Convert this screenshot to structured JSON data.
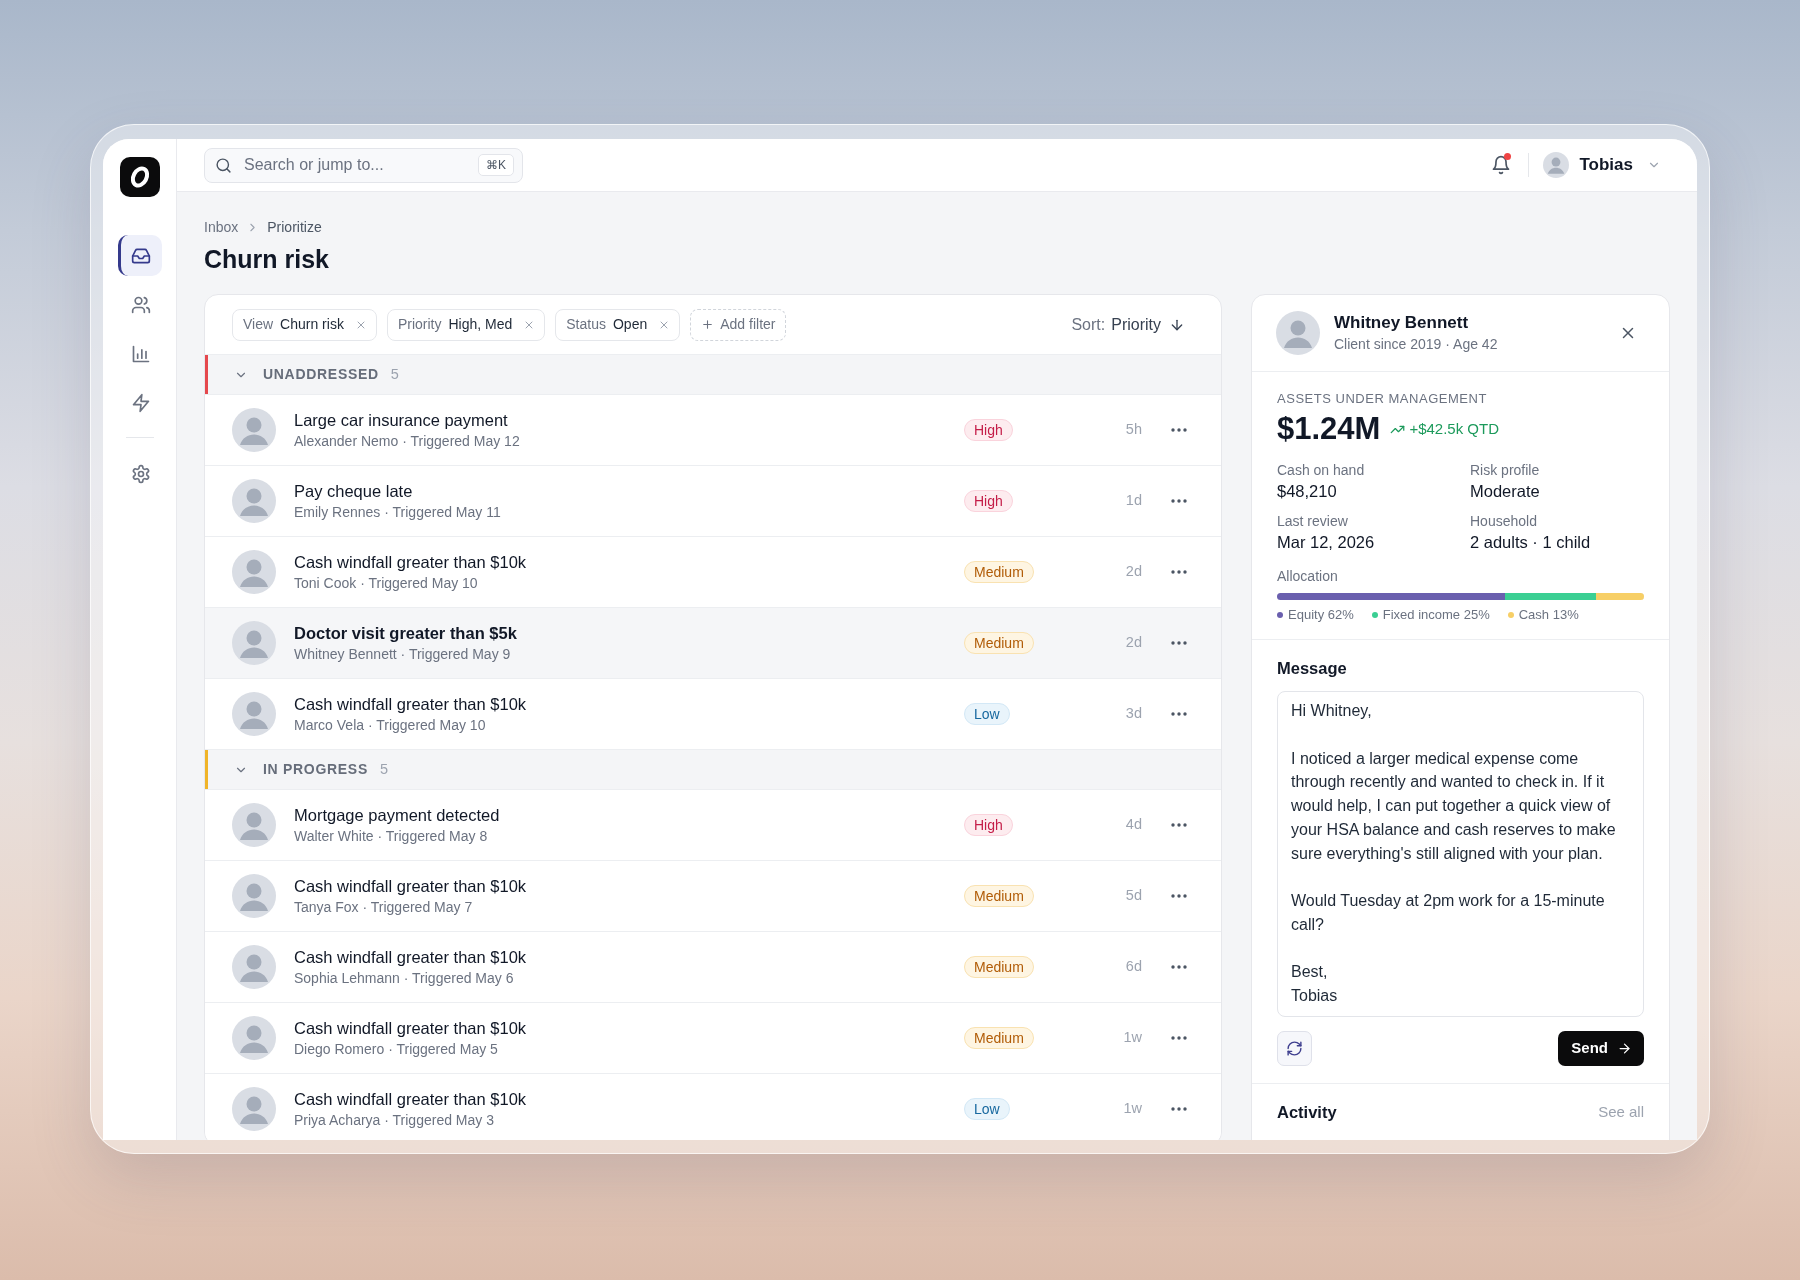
{
  "sidebar": {
    "items": [
      {
        "selected": true
      },
      {
        "selected": false
      },
      {
        "selected": false
      },
      {
        "selected": false
      }
    ],
    "footer_items": [
      {
        "selected": false
      }
    ]
  },
  "search": {
    "placeholder": "Search or jump to...",
    "shortcut": "⌘K"
  },
  "notifications": {
    "unread": true
  },
  "user": {
    "name": "Tobias"
  },
  "breadcrumb": [
    "Inbox",
    "Prioritize"
  ],
  "title": "Churn risk",
  "filters": [
    {
      "label": "View",
      "value": "Churn risk"
    },
    {
      "label": "Priority",
      "value": "High, Med"
    },
    {
      "label": "Status",
      "value": "Open"
    }
  ],
  "add_filter": "Add filter",
  "sort": {
    "label": "Sort:",
    "value": "Priority"
  },
  "groups": [
    {
      "title": "UNADDRESSED",
      "count": "5",
      "color": "#e5484d",
      "expanded": true,
      "rows": [
        {
          "title": "Large car insurance payment",
          "subtitle": "Alexander Nemo · Triggered May 12",
          "priority": {
            "label": "High",
            "kind": "high"
          },
          "age": "5h",
          "selected": false
        },
        {
          "title": "Pay cheque late",
          "subtitle": "Emily Rennes · Triggered May 11",
          "priority": {
            "label": "High",
            "kind": "high"
          },
          "age": "1d",
          "selected": false
        },
        {
          "title": "Cash windfall greater than $10k",
          "subtitle": "Toni Cook · Triggered May 10",
          "priority": {
            "label": "Medium",
            "kind": "medium"
          },
          "age": "2d",
          "selected": false
        },
        {
          "title": "Doctor visit greater than $5k",
          "subtitle": "Whitney Bennett · Triggered May 9",
          "priority": {
            "label": "Medium",
            "kind": "medium"
          },
          "age": "2d",
          "selected": true
        },
        {
          "title": "Cash windfall greater than $10k",
          "subtitle": "Marco Vela · Triggered May 10",
          "priority": {
            "label": "Low",
            "kind": "low"
          },
          "age": "3d",
          "selected": false
        }
      ]
    },
    {
      "title": "IN PROGRESS",
      "count": "5",
      "color": "#f0b429",
      "expanded": true,
      "rows": [
        {
          "title": "Mortgage payment detected",
          "subtitle": "Walter White · Triggered May 8",
          "priority": {
            "label": "High",
            "kind": "high"
          },
          "age": "4d",
          "selected": false
        },
        {
          "title": "Cash windfall greater than $10k",
          "subtitle": "Tanya Fox · Triggered May 7",
          "priority": {
            "label": "Medium",
            "kind": "medium"
          },
          "age": "5d",
          "selected": false
        },
        {
          "title": "Cash windfall greater than $10k",
          "subtitle": "Sophia Lehmann · Triggered May 6",
          "priority": {
            "label": "Medium",
            "kind": "medium"
          },
          "age": "6d",
          "selected": false
        },
        {
          "title": "Cash windfall greater than $10k",
          "subtitle": "Diego Romero · Triggered May 5",
          "priority": {
            "label": "Medium",
            "kind": "medium"
          },
          "age": "1w",
          "selected": false
        },
        {
          "title": "Cash windfall greater than $10k",
          "subtitle": "Priya Acharya · Triggered May 3",
          "priority": {
            "label": "Low",
            "kind": "low"
          },
          "age": "1w",
          "selected": false
        }
      ]
    }
  ],
  "detail": {
    "client": {
      "name": "Whitney Bennett",
      "subtitle": "Client since 2019 · Age 42"
    },
    "aum": {
      "label": "ASSETS UNDER MANAGEMENT",
      "value": "$1.24M",
      "change": "+$42.5k QTD"
    },
    "facts": [
      {
        "label": "Cash on hand",
        "value": "$48,210"
      },
      {
        "label": "Risk profile",
        "value": "Moderate"
      },
      {
        "label": "Last review",
        "value": "Mar 12, 2026"
      },
      {
        "label": "Household",
        "value": "2 adults · 1 child"
      }
    ],
    "allocation": {
      "label": "Allocation",
      "bar": [
        {
          "level": 0.62,
          "color": "#6a5fae"
        },
        {
          "level": 0.25,
          "color": "#3bcf93"
        },
        {
          "level": 0.13,
          "color": "#f7cf66"
        }
      ],
      "legend": [
        {
          "label": "Equity 62%",
          "color": "#6a5fae"
        },
        {
          "label": "Fixed income 25%",
          "color": "#3bcf93"
        },
        {
          "label": "Cash 13%",
          "color": "#f7cf66"
        }
      ]
    },
    "message": {
      "label": "Message",
      "value": "Hi Whitney,\n\nI noticed a larger medical expense come through recently and wanted to check in. If it would help, I can put together a quick view of your HSA balance and cash reserves to make sure everything's still aligned with your plan.\n\nWould Tuesday at 2pm work for a 15-minute call?\n\nBest,\nTobias"
    },
    "send": "Send",
    "activity": {
      "title": "Activity",
      "link": "See all"
    }
  }
}
